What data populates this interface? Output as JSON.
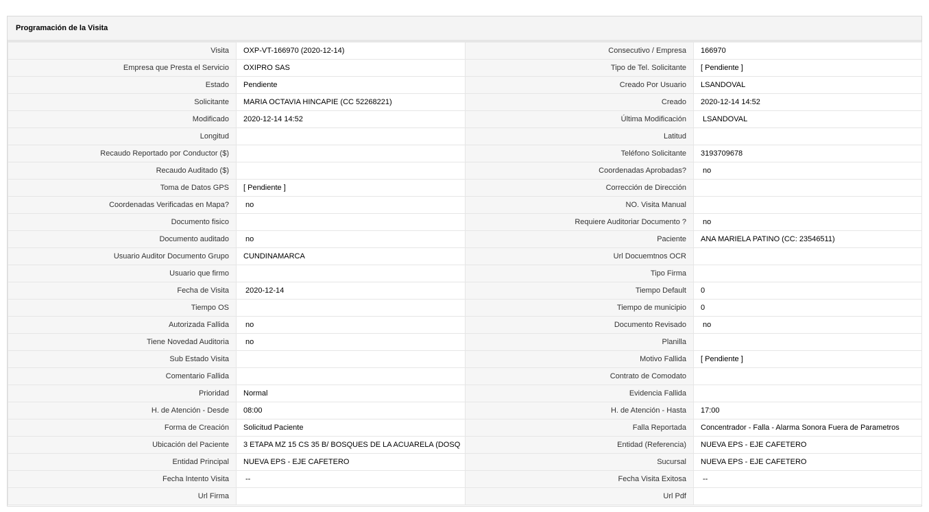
{
  "panel": {
    "title": "Programación de la Visita"
  },
  "rows": [
    {
      "l1": "Visita",
      "v1": "OXP-VT-166970 (2020-12-14)",
      "l2": "Consecutivo / Empresa",
      "v2": "166970"
    },
    {
      "l1": "Empresa que Presta el Servicio",
      "v1": "OXIPRO SAS",
      "l2": "Tipo de Tel. Solicitante",
      "v2": "[ Pendiente ]"
    },
    {
      "l1": "Estado",
      "v1": "Pendiente",
      "l2": "Creado Por Usuario",
      "v2": "LSANDOVAL"
    },
    {
      "l1": "Solicitante",
      "v1": "MARIA OCTAVIA HINCAPIE (CC 52268221)",
      "l2": "Creado",
      "v2": "2020-12-14 14:52"
    },
    {
      "l1": "Modificado",
      "v1": "2020-12-14 14:52",
      "l2": "Última Modificación",
      "v2": "LSANDOVAL"
    },
    {
      "l1": "Longitud",
      "v1": "",
      "l2": "Latitud",
      "v2": ""
    },
    {
      "l1": "Recaudo Reportado por Conductor ($)",
      "v1": "",
      "l2": "Teléfono Solicitante",
      "v2": "3193709678"
    },
    {
      "l1": "Recaudo Auditado ($)",
      "v1": "",
      "l2": "Coordenadas Aprobadas?",
      "v2": "no"
    },
    {
      "l1": "Toma de Datos GPS",
      "v1": "[ Pendiente ]",
      "l2": "Corrección de Dirección",
      "v2": ""
    },
    {
      "l1": "Coordenadas Verificadas en Mapa?",
      "v1": "no",
      "l2": "NO. Visita Manual",
      "v2": ""
    },
    {
      "l1": "Documento fisico",
      "v1": "",
      "l2": "Requiere Auditoriar Documento ?",
      "v2": "no"
    },
    {
      "l1": "Documento auditado",
      "v1": "no",
      "l2": "Paciente",
      "v2": "ANA MARIELA PATINO (CC: 23546511)"
    },
    {
      "l1": "Usuario Auditor Documento Grupo",
      "v1": "CUNDINAMARCA",
      "l2": "Url Docuemtnos OCR",
      "v2": ""
    },
    {
      "l1": "Usuario que firmo",
      "v1": "",
      "l2": "Tipo Firma",
      "v2": ""
    },
    {
      "l1": "Fecha de Visita",
      "v1": "2020-12-14",
      "l2": "Tiempo Default",
      "v2": "0"
    },
    {
      "l1": "Tiempo OS",
      "v1": "",
      "l2": "Tiempo de municipio",
      "v2": "0"
    },
    {
      "l1": "Autorizada Fallida",
      "v1": "no",
      "l2": "Documento Revisado",
      "v2": "no"
    },
    {
      "l1": "Tiene Novedad Auditoria",
      "v1": "no",
      "l2": "Planilla",
      "v2": ""
    },
    {
      "l1": "Sub Estado Visita",
      "v1": "",
      "l2": "Motivo Fallida",
      "v2": "[ Pendiente ]"
    },
    {
      "l1": "Comentario Fallida",
      "v1": "",
      "l2": "Contrato de Comodato",
      "v2": ""
    },
    {
      "l1": "Prioridad",
      "v1": "Normal",
      "l2": "Evidencia Fallida",
      "v2": ""
    },
    {
      "l1": "H. de Atención - Desde",
      "v1": "08:00",
      "l2": "H. de Atención - Hasta",
      "v2": "17:00"
    },
    {
      "l1": "Forma de Creación",
      "v1": "Solicitud Paciente",
      "l2": "Falla Reportada",
      "v2": "Concentrador - Falla - Alarma Sonora Fuera de Parametros"
    },
    {
      "l1": "Ubicación del Paciente",
      "v1": "3 ETAPA MZ 15 CS 35 B/ BOSQUES DE LA ACUARELA (DOSQ",
      "l2": "Entidad (Referencia)",
      "v2": "NUEVA EPS - EJE CAFETERO"
    },
    {
      "l1": "Entidad Principal",
      "v1": "NUEVA EPS - EJE CAFETERO",
      "l2": "Sucursal",
      "v2": "NUEVA EPS - EJE CAFETERO"
    },
    {
      "l1": "Fecha Intento Visita",
      "v1": "--",
      "l2": "Fecha Visita Exitosa",
      "v2": "--"
    },
    {
      "l1": "Url Firma",
      "v1": "",
      "l2": "Url Pdf",
      "v2": ""
    }
  ]
}
